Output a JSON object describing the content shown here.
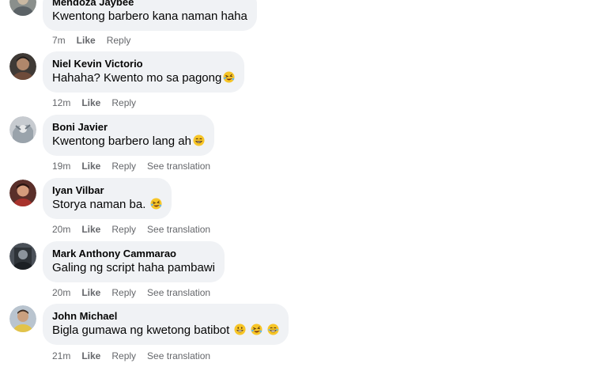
{
  "comments": [
    {
      "author": "Mendoza Jaybee",
      "text": "Kwentong barbero kana naman haha",
      "time": "7m",
      "like": "Like",
      "reply": "Reply",
      "translation": ""
    },
    {
      "author": "Niel Kevin Victorio",
      "text": "Hahaha? Kwento mo sa pagong",
      "time": "12m",
      "like": "Like",
      "reply": "Reply",
      "translation": ""
    },
    {
      "author": "Boni Javier",
      "text": "Kwentong barbero lang ah",
      "time": "19m",
      "like": "Like",
      "reply": "Reply",
      "translation": "See translation"
    },
    {
      "author": "Iyan Vilbar",
      "text": "Storya naman ba.",
      "time": "20m",
      "like": "Like",
      "reply": "Reply",
      "translation": "See translation"
    },
    {
      "author": "Mark Anthony Cammarao",
      "text": "Galing ng script haha pambawi",
      "time": "20m",
      "like": "Like",
      "reply": "Reply",
      "translation": "See translation"
    },
    {
      "author": "John Michael",
      "text": "Bigla gumawa ng kwetong batibot",
      "time": "21m",
      "like": "Like",
      "reply": "Reply",
      "translation": "See translation"
    }
  ],
  "icons": {
    "laugh": "rolling-on-floor-laughing-emoji",
    "grin": "grinning-face-emoji",
    "beam": "beaming-face-emoji"
  },
  "colors": {
    "bubble": "#f0f2f5",
    "meta": "#65676b",
    "text": "#050505",
    "emoji": "#f7c527"
  }
}
